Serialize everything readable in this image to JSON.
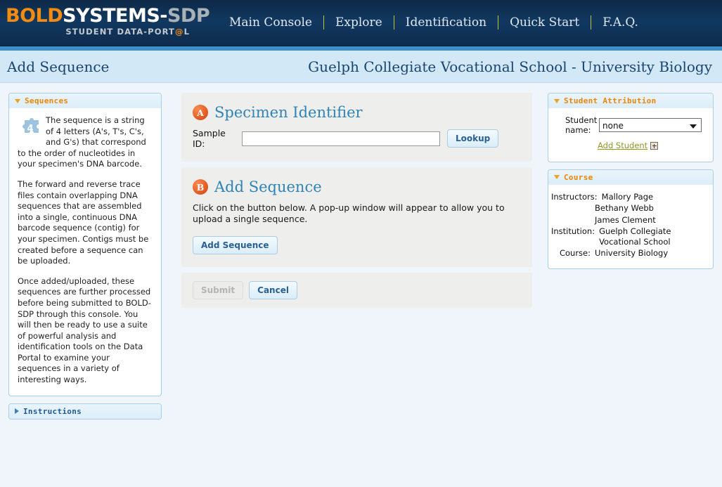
{
  "brand": {
    "logo_bold": "BOLD",
    "logo_systems": "SYSTEMS-",
    "logo_sdp": "SDP",
    "tagline_pre": "STUDENT DATA-PORT",
    "tagline_at": "@",
    "tagline_post": "L",
    "accent_orange": "#f28c10",
    "accent_green": "#b9c936",
    "header_navy": "#123860",
    "stripe_blue": "#3d8fc6"
  },
  "nav": {
    "items": [
      {
        "label": "Main Console"
      },
      {
        "label": "Explore"
      },
      {
        "label": "Identification"
      },
      {
        "label": "Quick Start"
      },
      {
        "label": "F.A.Q."
      }
    ]
  },
  "subheader": {
    "title": "Add Sequence",
    "course_line": "Guelph Collegiate Vocational School - University Biology"
  },
  "sidebar_left": {
    "sequences_panel": {
      "header": "Sequences",
      "icon": "puzzle-piece-4-icon",
      "paragraphs": [
        "The sequence is a string of 4 letters (A's, T's, C's, and G's) that correspond to the order of nucleotides in your specimen's DNA barcode.",
        "The forward and reverse trace files contain overlapping DNA sequences that are assembled into a single, continuous DNA barcode sequence (contig) for your specimen. Contigs must be created before a sequence can be uploaded.",
        "Once added/uploaded, these sequences are further processed before being submitted to BOLD-SDP through this console. You will then be ready to use a suite of powerful analysis and identification tools on the Data Portal to examine your sequences in a variety of interesting ways."
      ]
    },
    "instructions_panel": {
      "header": "Instructions"
    }
  },
  "main": {
    "section_a": {
      "badge": "A",
      "title": "Specimen Identifier",
      "sample_id_label": "Sample ID:",
      "sample_id_value": "",
      "sample_id_placeholder": "",
      "lookup_label": "Lookup"
    },
    "section_b": {
      "badge": "B",
      "title": "Add Sequence",
      "description": "Click on the button below. A pop-up window will appear to allow you to upload a single sequence.",
      "add_sequence_label": "Add Sequence"
    },
    "footer": {
      "submit_label": "Submit",
      "submit_disabled": true,
      "cancel_label": "Cancel"
    }
  },
  "sidebar_right": {
    "student_attribution": {
      "header": "Student Attribution",
      "student_name_label_line1": "Student",
      "student_name_label_line2": "name:",
      "selected_student": "none",
      "options": [
        "none"
      ],
      "add_student_label": "Add Student"
    },
    "course": {
      "header": "Course",
      "rows": [
        {
          "label": "Instructors:",
          "value": "Mallory Page"
        },
        {
          "label": "",
          "value": "Bethany Webb"
        },
        {
          "label": "",
          "value": "James Clement"
        },
        {
          "label": "Institution:",
          "value": "Guelph Collegiate Vocational School"
        },
        {
          "label": "Course:",
          "value": "University Biology"
        }
      ]
    }
  }
}
